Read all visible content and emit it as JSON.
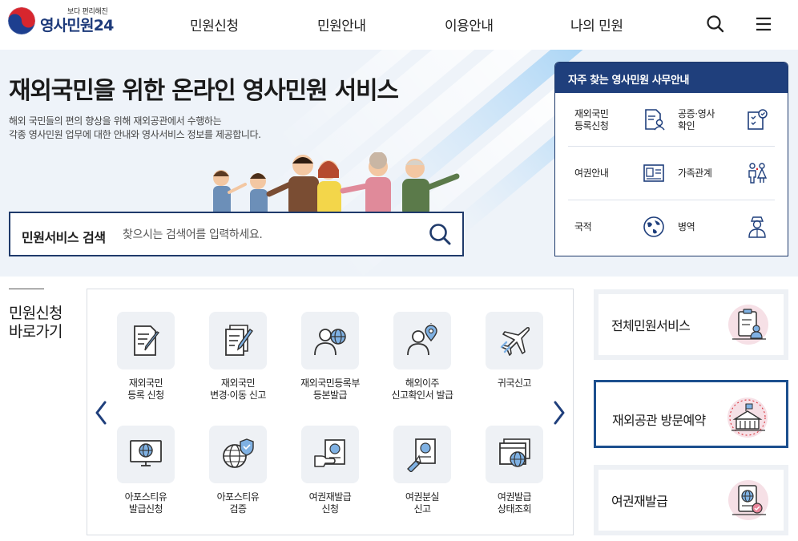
{
  "header": {
    "logo_sub": "보다 편리해진",
    "logo_main": "영사민원24",
    "nav": [
      {
        "label": "민원신청"
      },
      {
        "label": "민원안내"
      },
      {
        "label": "이용안내"
      },
      {
        "label": "나의 민원"
      }
    ],
    "icons": [
      "search-icon",
      "menu-icon"
    ]
  },
  "hero": {
    "title": "재외국민을 위한 온라인 영사민원 서비스",
    "desc_line1": "해외 국민들의 편의 향상을 위해 재외공관에서 수행하는",
    "desc_line2": "각종 영사민원 업무에 대한 안내와 영사서비스 정보를 제공합니다.",
    "search_label": "민원서비스 검색",
    "search_placeholder": "찾으시는 검색어를 입력하세요.",
    "search_value": ""
  },
  "quick": {
    "title": "자주 찾는 영사민원 사무안내",
    "items": [
      {
        "label": "재외국민\n등록신청",
        "icon": "registration-document-icon"
      },
      {
        "label": "공증·영사\n확인",
        "icon": "notary-check-icon"
      },
      {
        "label": "여권안내",
        "icon": "passport-icon"
      },
      {
        "label": "가족관계",
        "icon": "family-icon"
      },
      {
        "label": "국적",
        "icon": "globe-icon"
      },
      {
        "label": "병역",
        "icon": "soldier-icon"
      }
    ]
  },
  "shortcut": {
    "title_line1": "민원신청",
    "title_line2": "바로가기"
  },
  "services": [
    {
      "label": "재외국민\n등록 신청",
      "icon": "document-pen-icon"
    },
    {
      "label": "재외국민\n변경·이동 신고",
      "icon": "document-edit-icon"
    },
    {
      "label": "재외국민등록부\n등본발급",
      "icon": "person-globe-icon"
    },
    {
      "label": "해외이주\n신고확인서 발급",
      "icon": "person-location-icon"
    },
    {
      "label": "귀국신고",
      "icon": "airplane-icon"
    },
    {
      "label": "아포스티유\n발급신청",
      "icon": "monitor-globe-icon"
    },
    {
      "label": "아포스티유\n검증",
      "icon": "globe-shield-icon"
    },
    {
      "label": "여권재발급\n신청",
      "icon": "passport-hand-icon"
    },
    {
      "label": "여권분실\n신고",
      "icon": "passport-lost-icon"
    },
    {
      "label": "여권발급\n상태조회",
      "icon": "window-globe-icon"
    }
  ],
  "big_buttons": [
    {
      "label": "전체민원서비스",
      "icon": "clipboard-person-icon"
    },
    {
      "label": "재외공관 방문예약",
      "icon": "building-calendar-icon"
    },
    {
      "label": "여권재발급",
      "icon": "passport-check-icon"
    }
  ],
  "colors": {
    "brand_navy": "#1f3f7c",
    "hero_bg": "#eef3f9",
    "tile_bg": "#eef1f5",
    "active_border": "#1c4f8e"
  }
}
